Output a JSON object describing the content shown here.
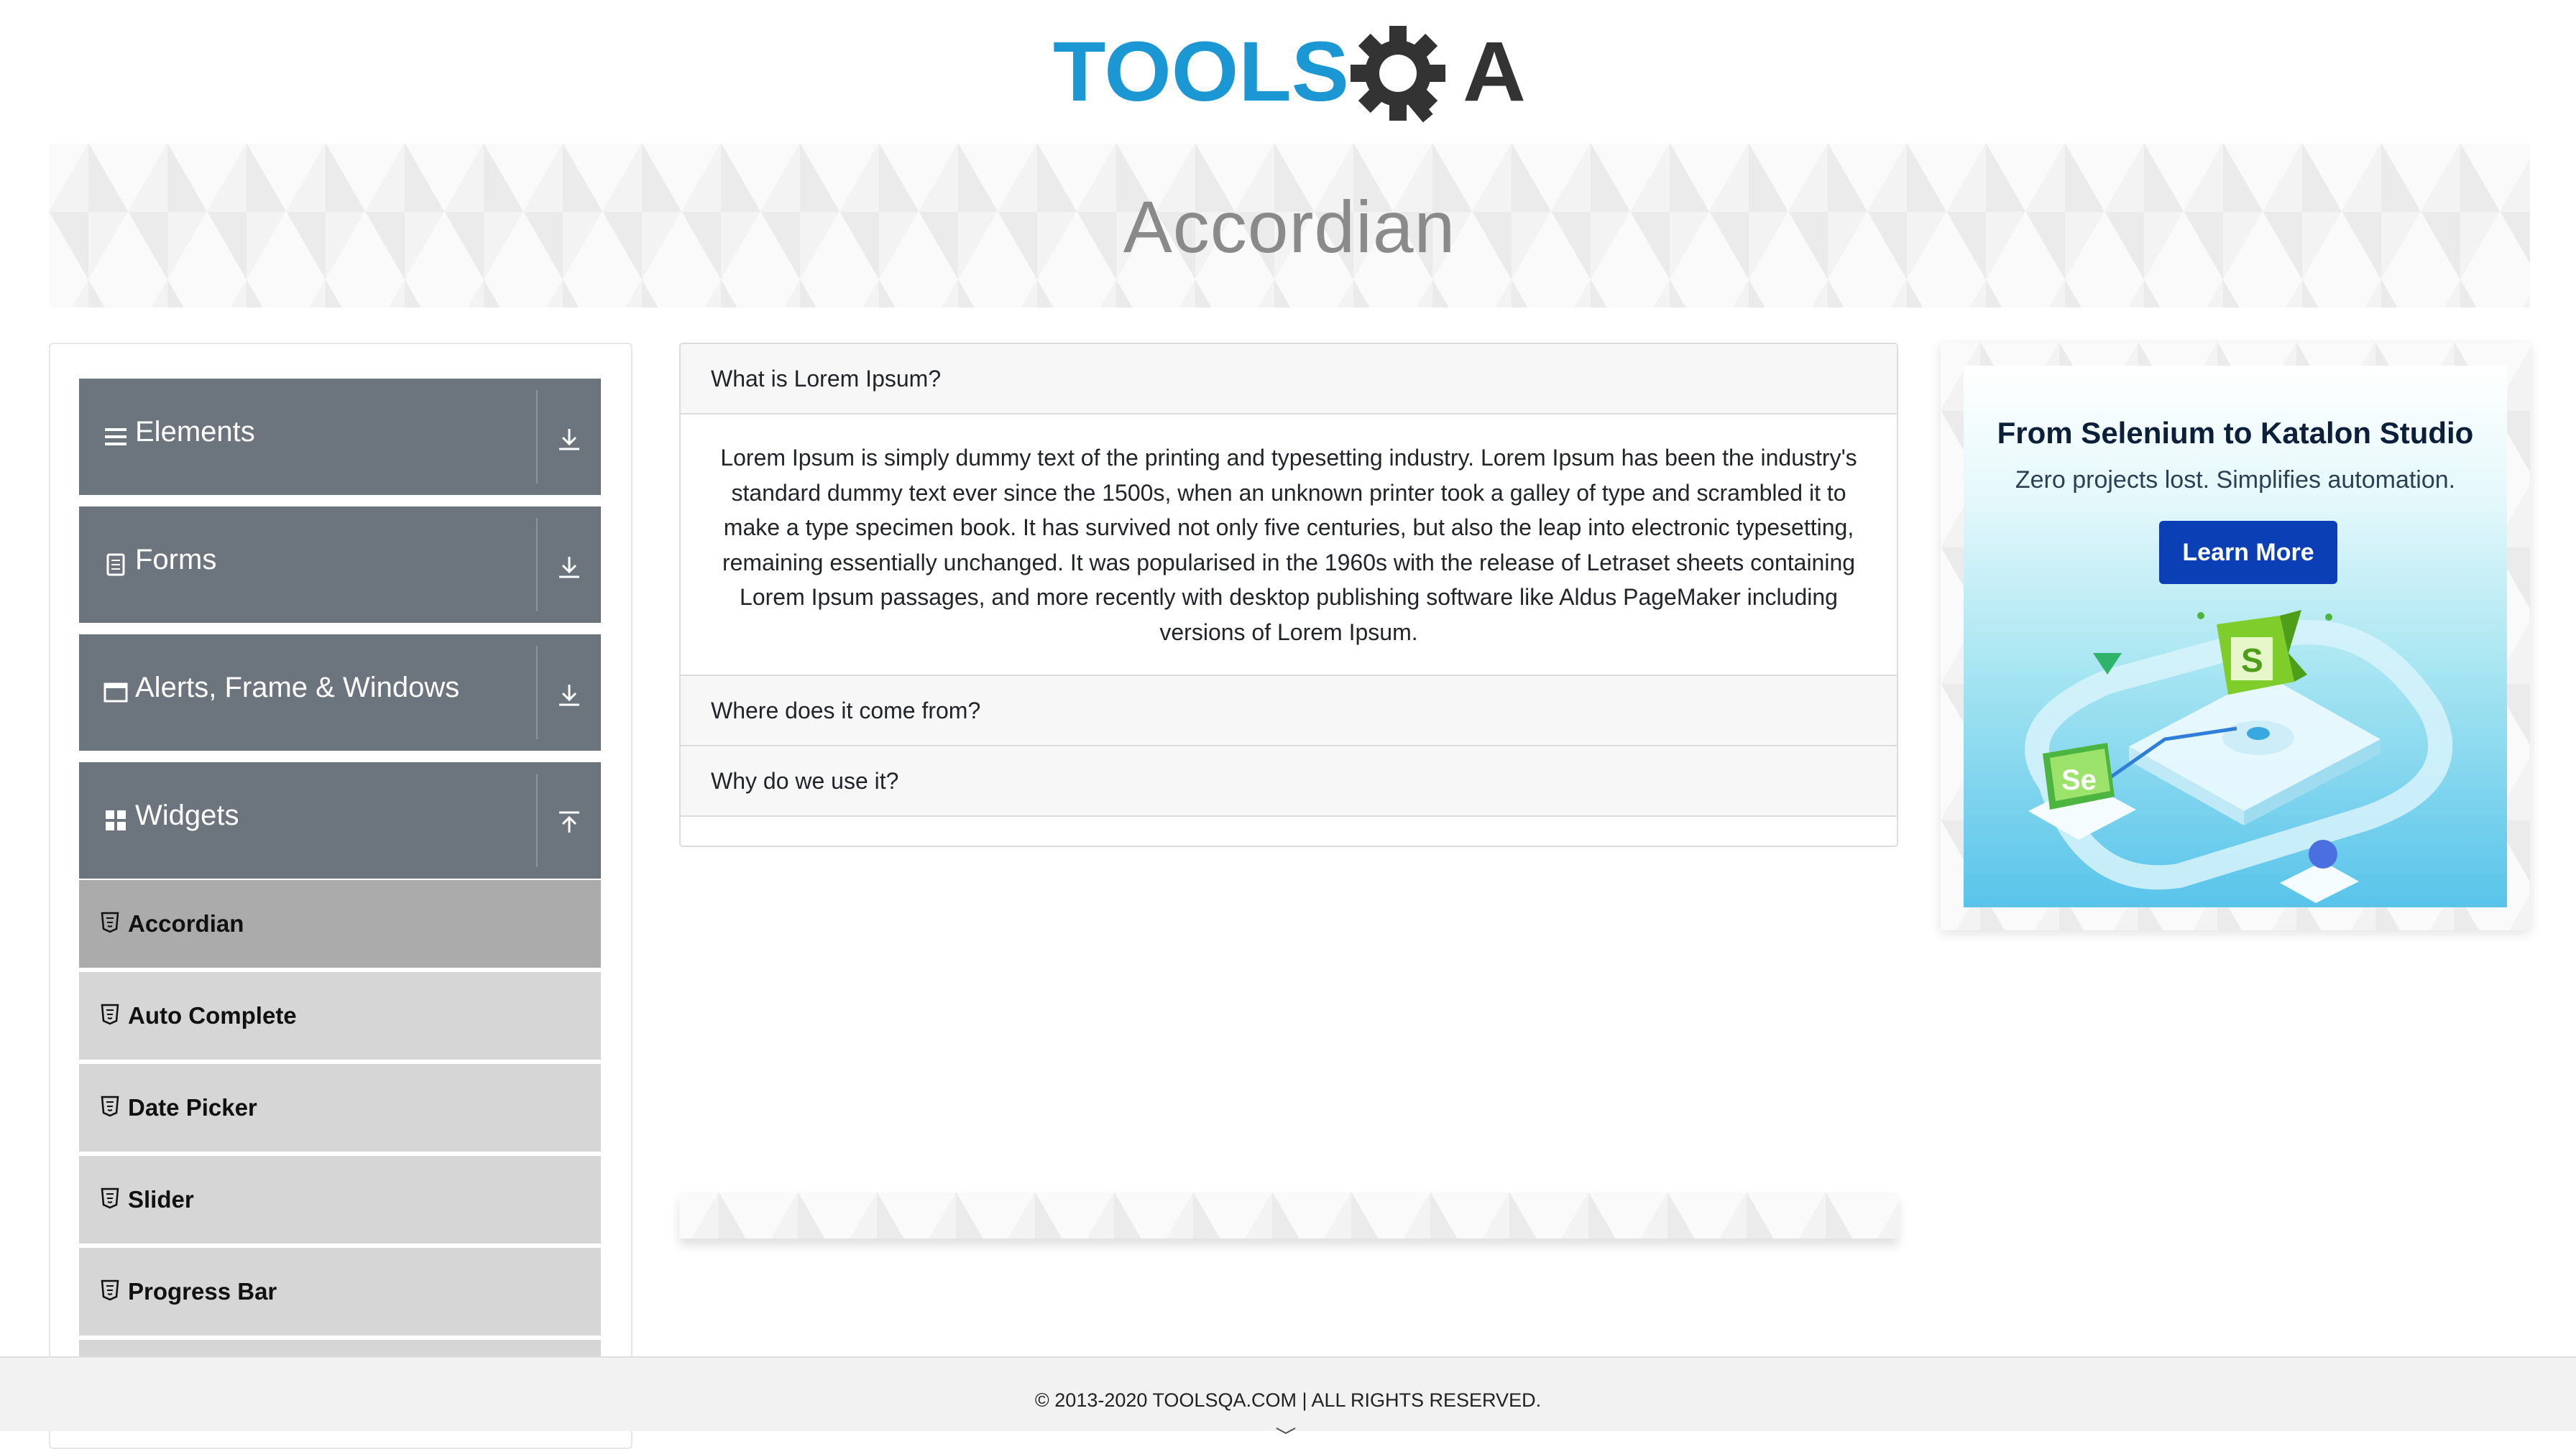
{
  "logo": {
    "text_left": "TOOLS",
    "text_right": "A"
  },
  "page": {
    "title": "Accordian"
  },
  "sidebar": {
    "groups": [
      {
        "label": "Elements",
        "icon": "menu-lines-icon",
        "arrow": "download-arrow-icon"
      },
      {
        "label": "Forms",
        "icon": "form-icon",
        "arrow": "download-arrow-icon"
      },
      {
        "label": "Alerts, Frame & Windows",
        "icon": "window-icon",
        "arrow": "download-arrow-icon"
      },
      {
        "label": "Widgets",
        "icon": "grid-icon",
        "arrow": "upload-arrow-icon"
      }
    ],
    "widget_items": [
      {
        "label": "Accordian",
        "active": true
      },
      {
        "label": "Auto Complete",
        "active": false
      },
      {
        "label": "Date Picker",
        "active": false
      },
      {
        "label": "Slider",
        "active": false
      },
      {
        "label": "Progress Bar",
        "active": false
      }
    ]
  },
  "accordion": {
    "sections": [
      {
        "heading": "What is Lorem Ipsum?",
        "expanded": true
      },
      {
        "heading": "Where does it come from?",
        "expanded": false
      },
      {
        "heading": "Why do we use it?",
        "expanded": false
      }
    ],
    "body_text": "Lorem Ipsum is simply dummy text of the printing and typesetting industry. Lorem Ipsum has been the industry's standard dummy text ever since the 1500s, when an unknown printer took a galley of type and scrambled it to make a type specimen book. It has survived not only five centuries, but also the leap into electronic typesetting, remaining essentially unchanged. It was popularised in the 1960s with the release of Letraset sheets containing Lorem Ipsum passages, and more recently with desktop publishing software like Aldus PageMaker including versions of Lorem Ipsum."
  },
  "ad": {
    "title": "From Selenium to Katalon Studio",
    "subtitle": "Zero projects lost. Simplifies automation.",
    "button": "Learn More",
    "badge_left": "Se",
    "badge_right": "S"
  },
  "footer": {
    "text": "© 2013-2020 TOOLSQA.COM | ALL RIGHTS RESERVED."
  },
  "colors": {
    "sidebar_header": "#6c757d",
    "menu_item": "#d6d6d6",
    "menu_item_active": "#ababab",
    "brand_blue": "#1b98d4",
    "brand_dark": "#333333",
    "ad_button": "#0b3fb6"
  }
}
